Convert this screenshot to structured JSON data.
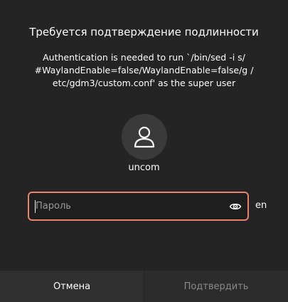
{
  "dialog": {
    "title": "Требуется подтверждение подлинности",
    "message": "Authentication is needed to run `/bin/sed -i s/\n#WaylandEnable=false/WaylandEnable=false/g /\netc/gdm3/custom.conf' as the super user",
    "user": {
      "avatar_icon": "user-icon",
      "name": "uncom"
    },
    "password": {
      "placeholder": "Пароль",
      "value": "",
      "reveal_icon": "eye-icon",
      "focus_color": "#e8826a"
    },
    "keyboard_layout": "en",
    "buttons": {
      "cancel_label": "Отмена",
      "confirm_label": "Подтвердить",
      "confirm_enabled": false
    }
  }
}
